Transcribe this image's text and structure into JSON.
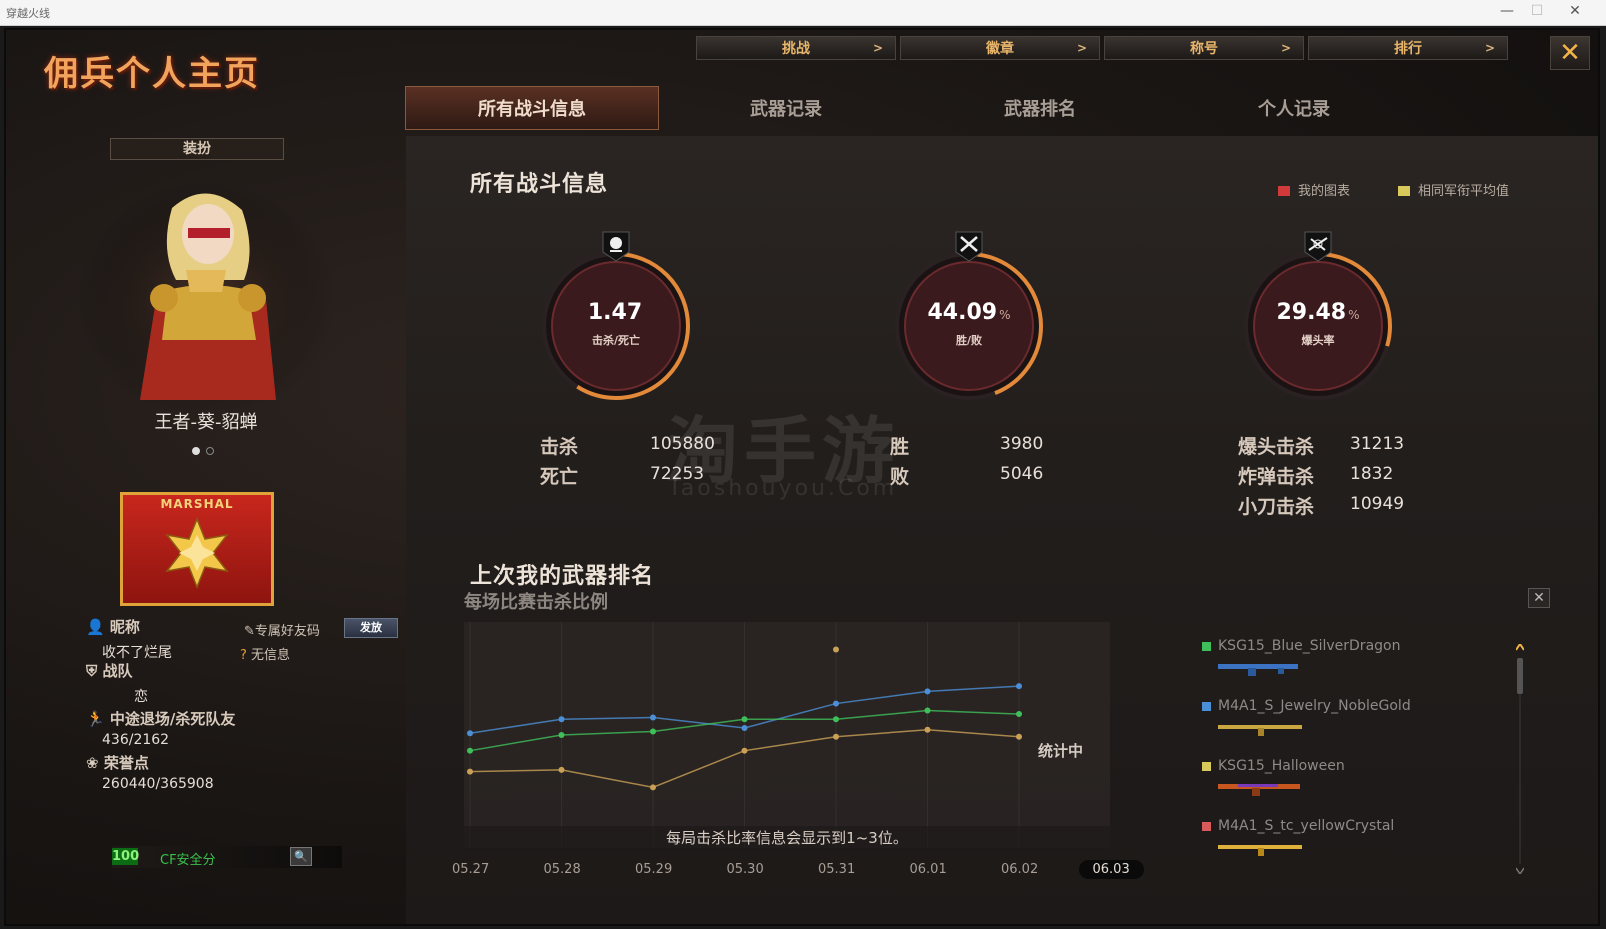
{
  "window": {
    "title": "穿越火线",
    "minimize": "—",
    "maximize": "☐",
    "close": "✕"
  },
  "header": {
    "logo": "佣兵个人主页",
    "topnav": [
      {
        "label": "挑战",
        "arrow": ">"
      },
      {
        "label": "徽章",
        "arrow": ">"
      },
      {
        "label": "称号",
        "arrow": ">"
      },
      {
        "label": "排行",
        "arrow": ">"
      }
    ],
    "close_glyph": "✕"
  },
  "tabs": [
    {
      "label": "所有战斗信息",
      "active": true
    },
    {
      "label": "武器记录",
      "active": false
    },
    {
      "label": "武器排名",
      "active": false
    },
    {
      "label": "个人记录",
      "active": false
    }
  ],
  "left": {
    "dress_button": "装扮",
    "character_name": "王者-葵-貂蝉",
    "rank_badge": "MARSHAL",
    "nickname_label": "昵称",
    "nickname": "收不了烂尾",
    "friend_code_label": "专属好友码",
    "send_button": "发放",
    "no_info": "无信息",
    "team_label": "战队",
    "team": "恋",
    "quit_label": "中途退场/杀死队友",
    "quit_value": "436/2162",
    "honor_label": "荣誉点",
    "honor_value": "260440/365908",
    "security_score": "100",
    "security_label": "CF安全分",
    "search_glyph": "🔍"
  },
  "main": {
    "title": "所有战斗信息",
    "legend": [
      {
        "label": "我的图表",
        "color": "#d13a3a"
      },
      {
        "label": "相同军衔平均值",
        "color": "#d9c85a"
      }
    ],
    "gauges": [
      {
        "value": "1.47",
        "unit": "",
        "label": "击杀/死亡",
        "icon": "skull-icon",
        "fraction": 0.59
      },
      {
        "value": "44.09",
        "unit": "%",
        "label": "胜/败",
        "icon": "crossed-swords-icon",
        "fraction": 0.4409
      },
      {
        "value": "29.48",
        "unit": "%",
        "label": "爆头率",
        "icon": "crossed-guns-icon",
        "fraction": 0.2948
      }
    ],
    "stats": {
      "kills_label": "击杀",
      "kills": "105880",
      "deaths_label": "死亡",
      "deaths": "72253",
      "wins_label": "胜",
      "wins": "3980",
      "losses_label": "败",
      "losses": "5046",
      "headshot_label": "爆头击杀",
      "headshot": "31213",
      "bomb_label": "炸弹击杀",
      "bomb": "1832",
      "knife_label": "小刀击杀",
      "knife": "10949"
    },
    "watermark": "淘手游",
    "watermark_url": "Taoshouyou.Com",
    "weapon_rank_title": "上次我的武器排名",
    "chart_subtitle": "每场比赛击杀比例",
    "counting": "统计中",
    "chart_note": "每局击杀比率信息会显示到1~3位。",
    "close_glyph": "✕"
  },
  "chart_data": {
    "type": "line",
    "title": "每场比赛击杀比例",
    "categories": [
      "05.27",
      "05.28",
      "05.29",
      "05.30",
      "05.31",
      "06.01",
      "06.02",
      "06.03"
    ],
    "selected_category": "06.03",
    "series": [
      {
        "name": "KSG15_Blue_SilverDragon",
        "color": "#4b8fd6",
        "values": [
          0.52,
          0.6,
          0.61,
          0.55,
          0.69,
          0.76,
          0.79
        ]
      },
      {
        "name": "M4A1_S_Jewelry_NobleGold",
        "color": "#3fbf5a",
        "values": [
          0.42,
          0.51,
          0.53,
          0.6,
          0.6,
          0.65,
          0.63
        ]
      },
      {
        "name": "KSG15_Halloween",
        "color": "#c9a055",
        "values": [
          0.3,
          0.31,
          0.21,
          0.42,
          0.5,
          0.54,
          0.5
        ]
      }
    ],
    "outlier_point": {
      "x": "05.31",
      "value": 1.0,
      "color": "#c9a055"
    },
    "ylim": [
      0,
      1.1
    ]
  },
  "weapons": [
    {
      "name": "KSG15_Blue_SilverDragon",
      "color": "#3fbf5a",
      "gun_color": "#3b73c2"
    },
    {
      "name": "M4A1_S_Jewelry_NobleGold",
      "color": "#4b8fd6",
      "gun_color": "#c9a640"
    },
    {
      "name": "KSG15_Halloween",
      "color": "#d9c85a",
      "gun_color": "#c8571f"
    },
    {
      "name": "M4A1_S_tc_yellowCrystal",
      "color": "#d95a5a",
      "gun_color": "#e0b13a"
    }
  ]
}
